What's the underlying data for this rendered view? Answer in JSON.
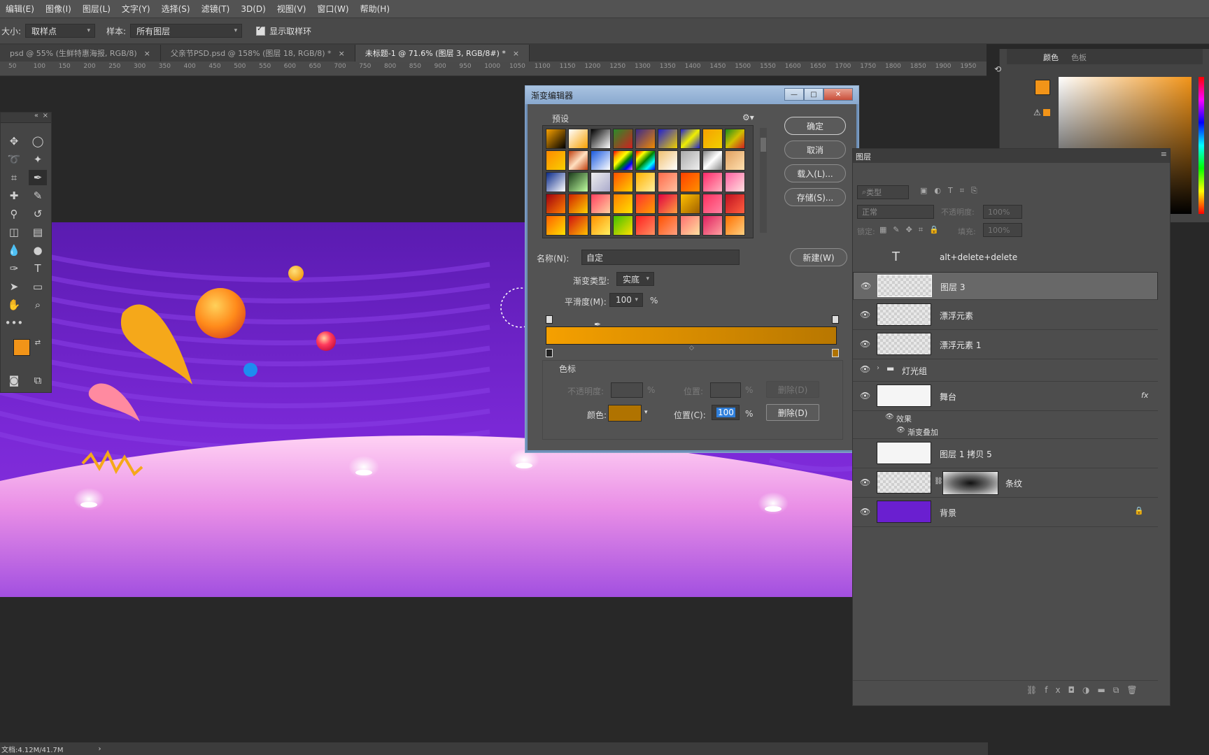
{
  "menu": [
    "编辑(E)",
    "图像(I)",
    "图层(L)",
    "文字(Y)",
    "选择(S)",
    "滤镜(T)",
    "3D(D)",
    "视图(V)",
    "窗口(W)",
    "帮助(H)"
  ],
  "options": {
    "size_label": "大小:",
    "size_value": "取样点",
    "sample_label": "样本:",
    "sample_value": "所有图层",
    "show_ring_label": "显示取样环"
  },
  "tabs": [
    {
      "label": "psd @ 55% (生鲜特惠海报, RGB/8)",
      "active": false
    },
    {
      "label": "父亲节PSD.psd @ 158% (图层 18, RGB/8) *",
      "active": false
    },
    {
      "label": "未标题-1 @ 71.6% (图层 3, RGB/8#) *",
      "active": true
    }
  ],
  "ruler_ticks": [
    "50",
    "100",
    "150",
    "200",
    "250",
    "300",
    "350",
    "400",
    "450",
    "500",
    "550",
    "600",
    "650",
    "700",
    "750",
    "800",
    "850",
    "900",
    "950",
    "1000",
    "1050",
    "1100",
    "1150",
    "1200",
    "1250",
    "1300",
    "1350",
    "1400",
    "1450",
    "1500",
    "1550",
    "1600",
    "1650",
    "1700",
    "1750",
    "1800",
    "1850",
    "1900",
    "1950"
  ],
  "gradient_editor": {
    "title": "渐变编辑器",
    "presets_label": "预设",
    "ok": "确定",
    "cancel": "取消",
    "load": "载入(L)...",
    "save": "存储(S)...",
    "new": "新建(W)",
    "name_label": "名称(N):",
    "name_value": "自定",
    "type_label": "渐变类型:",
    "type_value": "实底",
    "smooth_label": "平滑度(M):",
    "smooth_value": "100",
    "percent": "%",
    "stops_label": "色标",
    "opacity_label": "不透明度:",
    "position_label_dim": "位置:",
    "delete_dim": "删除(D)",
    "color_label": "颜色:",
    "position_label": "位置(C):",
    "position_value": "100",
    "delete": "删除(D)",
    "gradient_start": "#f5a000",
    "gradient_end": "#b87700",
    "stop_color": "#b07300"
  },
  "layers_panel": {
    "tab_label": "图层",
    "kind_placeholder": "类型",
    "blend_mode": "正常",
    "opacity_label": "不透明度:",
    "opacity_value": "100%",
    "lock_label": "锁定:",
    "fill_label": "填充:",
    "fill_value": "100%",
    "layers": [
      {
        "name": "alt+delete+delete",
        "type": "text"
      },
      {
        "name": "图层 3",
        "selected": true
      },
      {
        "name": "漂浮元素"
      },
      {
        "name": "漂浮元素 1"
      },
      {
        "name": "灯光组",
        "type": "group"
      },
      {
        "name": "舞台",
        "fx": "fx"
      },
      {
        "name": "效果",
        "type": "effect-header"
      },
      {
        "name": "渐变叠加",
        "type": "effect"
      },
      {
        "name": "图层 1 拷贝 5"
      },
      {
        "name": "条纹"
      },
      {
        "name": "背景",
        "type": "background"
      }
    ]
  },
  "color_panel": {
    "tab1": "颜色",
    "tab2": "色板",
    "fg": "#f29418",
    "bg": "#111111"
  },
  "status": {
    "doc": "文档:4.12M/41.7M"
  }
}
